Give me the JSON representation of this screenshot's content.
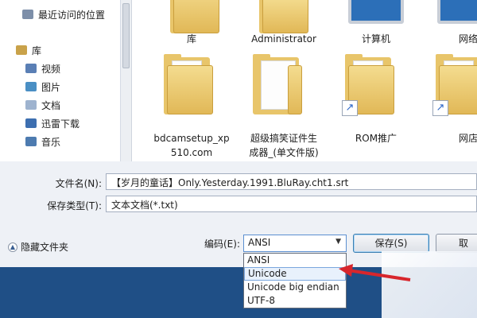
{
  "nav": {
    "items": [
      {
        "label": "最近访问的位置",
        "icon": "recent-places-icon"
      },
      {
        "label": "库",
        "icon": "library-icon"
      },
      {
        "label": "视频",
        "icon": "video-icon"
      },
      {
        "label": "图片",
        "icon": "pictures-icon"
      },
      {
        "label": "文档",
        "icon": "documents-icon"
      },
      {
        "label": "迅雷下载",
        "icon": "thunder-download-icon"
      },
      {
        "label": "音乐",
        "icon": "music-icon"
      }
    ]
  },
  "files": [
    {
      "name": "库",
      "icon": "library-folder-icon"
    },
    {
      "name": "Administrator",
      "icon": "user-folder-icon"
    },
    {
      "name": "计算机",
      "icon": "computer-icon"
    },
    {
      "name": "网络",
      "icon": "network-icon"
    },
    {
      "name_line1": "bdcamsetup_xp",
      "name_line2": "510.com",
      "icon": "folder-icon"
    },
    {
      "name_line1": "超级搞笑证件生",
      "name_line2": "成器_(单文件版)",
      "icon": "folder-icon"
    },
    {
      "name": "ROM推广",
      "icon": "folder-shortcut-icon"
    },
    {
      "name": "网店",
      "icon": "folder-shortcut-icon"
    }
  ],
  "form": {
    "filename_label": "文件名(N):",
    "filename_value": "【岁月的童话】Only.Yesterday.1991.BluRay.cht1.srt",
    "filetype_label": "保存类型(T):",
    "filetype_value": "文本文档(*.txt)",
    "hide_folders_label": "隐藏文件夹",
    "encoding_label": "编码(E):",
    "encoding_value": "ANSI",
    "save_label": "保存(S)",
    "cancel_label": "取"
  },
  "encoding_options": [
    "ANSI",
    "Unicode",
    "Unicode big endian",
    "UTF-8"
  ],
  "colors": {
    "dialog_bg": "#eef1f6",
    "taskbar": "#1f4f86",
    "annotation_arrow": "#d8262c",
    "folder": "#e8c56a"
  }
}
